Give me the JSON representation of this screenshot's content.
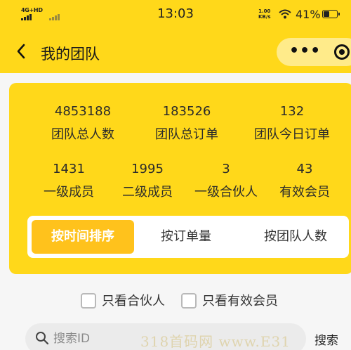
{
  "status_bar": {
    "network": "4G+HD",
    "time": "13:03",
    "speed_value": "1.00",
    "speed_unit": "KB/s",
    "battery": "41%"
  },
  "nav": {
    "title": "我的团队",
    "menu_dots": "•••"
  },
  "stats_top": [
    {
      "value": "4853188",
      "label": "团队总人数"
    },
    {
      "value": "183526",
      "label": "团队总订单"
    },
    {
      "value": "132",
      "label": "团队今日订单"
    }
  ],
  "stats_bottom": [
    {
      "value": "1431",
      "label": "一级成员"
    },
    {
      "value": "1995",
      "label": "二级成员"
    },
    {
      "value": "3",
      "label": "一级合伙人"
    },
    {
      "value": "43",
      "label": "有效会员"
    }
  ],
  "sort_tabs": [
    "按时间排序",
    "按订单量",
    "按团队人数"
  ],
  "active_sort": "按时间排序",
  "filters": [
    "只看合伙人",
    "只看有效会员"
  ],
  "search": {
    "placeholder": "搜索ID",
    "button": "搜索"
  },
  "watermark": "318首码网 www.E31",
  "colors": {
    "primary_yellow": "#ffd81a",
    "active_tab": "#ffc21c",
    "background": "#f6f6f6"
  }
}
